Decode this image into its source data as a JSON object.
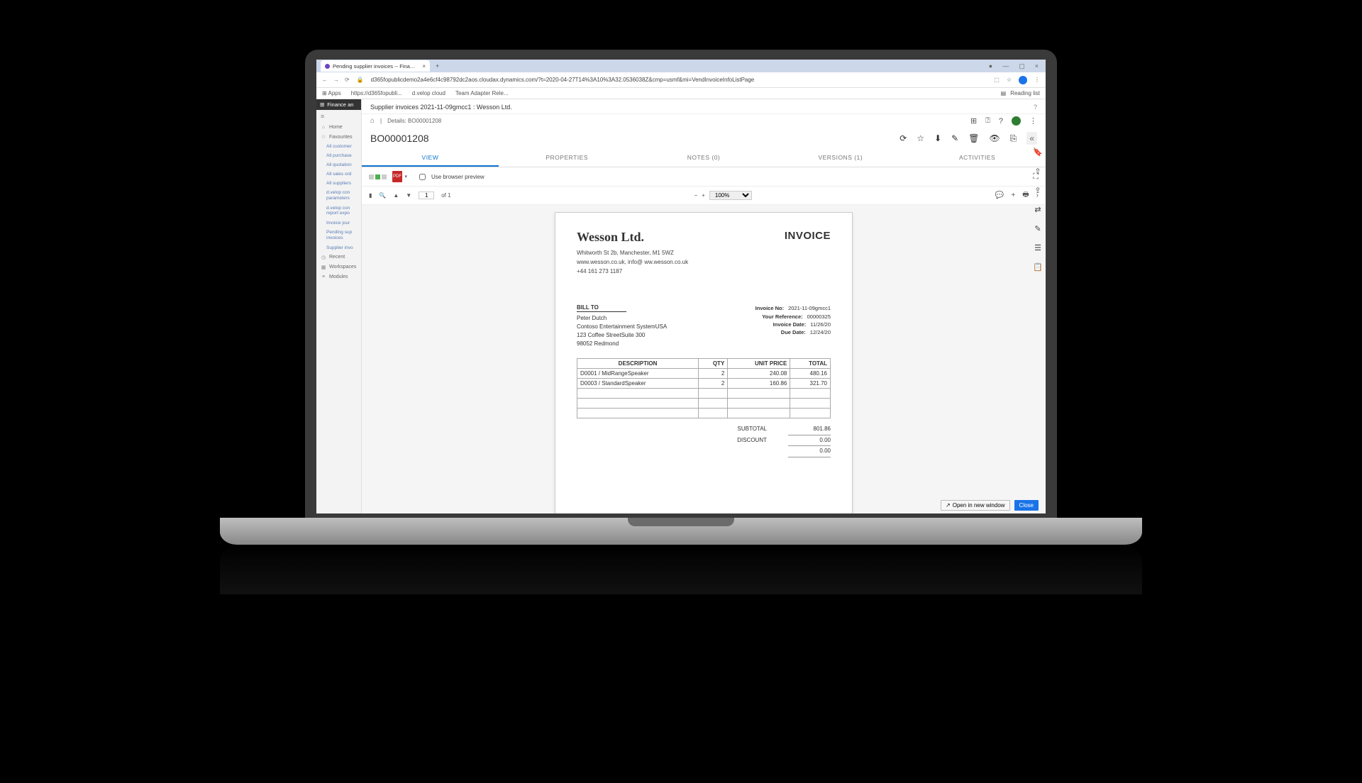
{
  "browser": {
    "tab_title": "Pending supplier invoices -- Fina…",
    "url": "d365fopublicdemo2a4e6cf4c98792dc2aos.cloudax.dynamics.com/?t=2020-04-27T14%3A10%3A32.0536038Z&cmp=usmf&mi=VendInvoiceInfoListPage",
    "bookmarks": [
      "Apps",
      "https://d365fopubli...",
      "d.velop cloud",
      "Team Adapter Rele..."
    ],
    "reading_list": "Reading list"
  },
  "sidebar": {
    "app_name": "Finance an",
    "items": [
      {
        "icon": "⌂",
        "label": "Home"
      },
      {
        "icon": "☆",
        "label": "Favourites"
      }
    ],
    "subitems": [
      "All customer",
      "All purchase",
      "All quotation",
      "All sales ord",
      "All suppliers",
      "d.velop con parameters",
      "d.velop con report expo",
      "Invoice jour",
      "Pending sup invoices",
      "Supplier invo"
    ],
    "footer": [
      {
        "icon": "◷",
        "label": "Recent"
      },
      {
        "icon": "▦",
        "label": "Workspaces"
      },
      {
        "icon": "≡",
        "label": "Modules"
      }
    ]
  },
  "header": {
    "title": "Supplier invoices 2021-11-09gmcc1 : Wesson Ltd.",
    "breadcrumb": "Details: BO00001208",
    "doc_id": "BO00001208"
  },
  "tabs": {
    "view": "VIEW",
    "properties": "PROPERTIES",
    "notes": "NOTES (0)",
    "versions": "VERSIONS (1)",
    "activities": "ACTIVITIES"
  },
  "pdfbar": {
    "use_browser_preview": "Use browser preview",
    "page_current": "1",
    "page_of": "of 1",
    "zoom": "100%"
  },
  "invoice": {
    "company": "Wesson Ltd.",
    "label": "INVOICE",
    "address": "Whitworth St 2b, Manchester, M1 5WZ",
    "web": "www.wesson.co.uk, info@ ww.wesson.co.uk",
    "phone": "+44 161 273 1187",
    "bill_to_label": "BILL TO",
    "bill_to": {
      "name": "Peter Dutch",
      "company": "Contoso Entertainment SystemUSA",
      "street": "123 Coffee StreetSuite 300",
      "city": "98052 Redmond"
    },
    "meta": {
      "invoice_no_k": "Invoice No:",
      "invoice_no_v": "2021-11-09gmcc1",
      "reference_k": "Your Reference:",
      "reference_v": "00000325",
      "invoice_date_k": "Invoice Date:",
      "invoice_date_v": "11/26/20",
      "due_date_k": "Due Date:",
      "due_date_v": "12/24/20"
    },
    "columns": {
      "desc": "DESCRIPTION",
      "qty": "QTY",
      "unit": "UNIT PRICE",
      "total": "TOTAL"
    },
    "lines": [
      {
        "desc": "D0001 / MidRangeSpeaker",
        "qty": "2",
        "unit": "240.08",
        "total": "480.16"
      },
      {
        "desc": "D0003 / StandardSpeaker",
        "qty": "2",
        "unit": "160.86",
        "total": "321.70"
      }
    ],
    "totals": {
      "subtotal_k": "SUBTOTAL",
      "subtotal_v": "801.86",
      "discount_k": "DISCOUNT",
      "discount_v": "0.00",
      "extra_v": "0.00"
    }
  },
  "footer": {
    "open": "Open in new window",
    "close": "Close"
  }
}
